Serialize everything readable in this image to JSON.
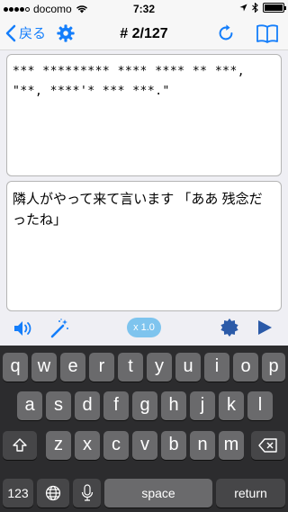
{
  "status_bar": {
    "carrier": "docomo",
    "time": "7:32",
    "battery_level": 1.0
  },
  "nav": {
    "back_label": "戻る",
    "title": "# 2/127",
    "icons": {
      "back": "chevron-left-icon",
      "settings": "gear-icon",
      "refresh": "refresh-icon",
      "book": "book-icon"
    }
  },
  "top_box": {
    "text": "*** ********* **** **** ** ***, \"**, ****'* *** ***.\""
  },
  "bottom_box": {
    "text": "隣人がやって来て言います 「ああ 残念だったね」"
  },
  "toolbar": {
    "speed_label": "x 1.0",
    "accent_color": "#147efb",
    "pill_color": "#7ec4ee"
  },
  "keyboard": {
    "row1": [
      "q",
      "w",
      "e",
      "r",
      "t",
      "y",
      "u",
      "i",
      "o",
      "p"
    ],
    "row2": [
      "a",
      "s",
      "d",
      "f",
      "g",
      "h",
      "j",
      "k",
      "l"
    ],
    "row3": [
      "z",
      "x",
      "c",
      "v",
      "b",
      "n",
      "m"
    ],
    "shift": "⇧",
    "delete": "⌫",
    "numbers": "123",
    "globe": "🌐",
    "mic": "🎤",
    "space": "space",
    "return": "return"
  }
}
